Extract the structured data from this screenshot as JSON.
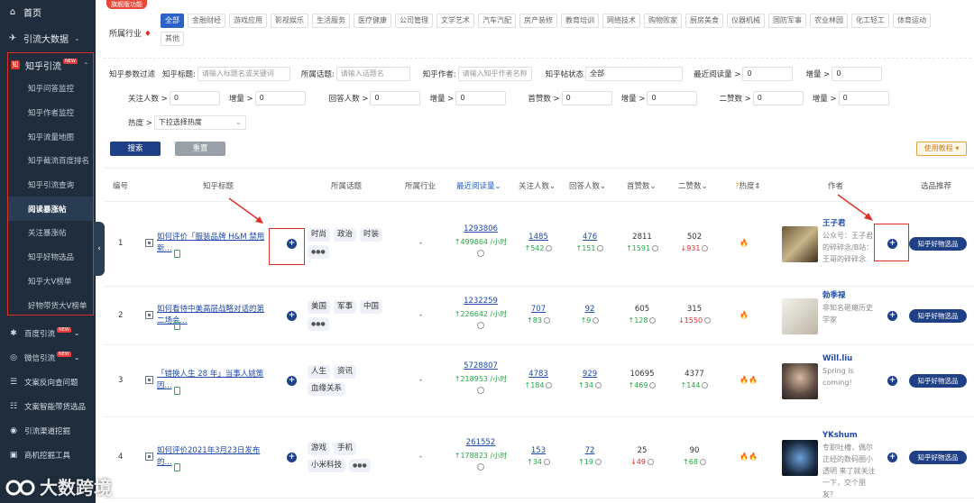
{
  "sidebar": {
    "home": "首页",
    "bigdata": "引流大数据",
    "zhihu_section": "知乎引流",
    "hot_badge": "NEW",
    "zhihu_items": [
      "知乎问答监控",
      "知乎作者监控",
      "知乎流量地图",
      "知乎截流百度排名",
      "知乎引流查询",
      "阅读暴涨帖",
      "关注暴涨帖",
      "知乎好物选品",
      "知乎大V榜单",
      "好物带货大V榜单"
    ],
    "active_index": 5,
    "baidu_section": "百度引流",
    "wechat_section": "微信引流",
    "lower_items": [
      "文案反向查问题",
      "文案智能带货选品",
      "引流渠道挖掘",
      "商机挖掘工具"
    ]
  },
  "filter": {
    "flagship_tag": "旗舰版功能",
    "industry_label": "所属行业",
    "industries": [
      "全部",
      "金融财经",
      "游戏应用",
      "影视娱乐",
      "生活服务",
      "医疗健康",
      "公司管理",
      "文学艺术",
      "汽车汽配",
      "房产装修",
      "教育培训",
      "网络技术",
      "购物败家",
      "厨房美食",
      "仪器机械",
      "国防军事",
      "农业林园",
      "化工轻工",
      "体育运动",
      "其他"
    ],
    "param_label": "知乎参数过滤",
    "title_label": "知乎标题:",
    "title_placeholder": "请输入标题名或关键词",
    "topic_label": "所属话题:",
    "topic_placeholder": "请输入话题名",
    "author_label": "知乎作者:",
    "author_placeholder": "请输入知乎作者名称",
    "status_label": "知乎帖状态",
    "status_value": "全部",
    "recent_read_label": "最近阅读量 >",
    "increase_label": "增量 >",
    "follow_label": "关注人数 >",
    "answer_label": "回答人数 >",
    "first_like_label": "首赞数 >",
    "second_like_label": "二赞数 >",
    "zero": "0",
    "heat_label": "热度 >",
    "heat_placeholder": "下拉选择热度",
    "search_btn": "搜索",
    "reset_btn": "重置",
    "tutorial_btn": "使用教程 ▾"
  },
  "table": {
    "headers": {
      "no": "编号",
      "title": "知乎标题",
      "topic": "所属话题",
      "industry": "所属行业",
      "recent_read": "最近阅读量",
      "follow": "关注人数",
      "answer": "回答人数",
      "first_like": "首赞数",
      "second_like": "二赞数",
      "heat": "热度",
      "author": "作者",
      "recommend": "选品推荐"
    },
    "rows": [
      {
        "no": "1",
        "title": "如何评价「服装品牌 H&M 禁用新...",
        "tags": [
          "时尚",
          "政治",
          "时装"
        ],
        "more": "●●●",
        "industry": "-",
        "read": "1293806",
        "read_inc": "↑499864 /小时",
        "follow": "1485",
        "follow_inc": "↑542",
        "answer": "476",
        "answer_inc": "↑151",
        "first": "2811",
        "first_inc": "↑1591",
        "second": "502",
        "second_inc": "↓931",
        "second_dir": "down",
        "heat": "🔥",
        "author": "王子君",
        "author_desc": "公众号：王子君的碎碎念/B站：王哥的碎碎念",
        "rec": "知乎好物选品"
      },
      {
        "no": "2",
        "title": "如何看待中美高层战略对话的第二场会...",
        "tags": [
          "美国",
          "军事",
          "中国"
        ],
        "more": "●●●",
        "industry": "-",
        "read": "1232259",
        "read_inc": "↑226642 /小时",
        "follow": "707",
        "follow_inc": "↑83",
        "answer": "92",
        "answer_inc": "↑9",
        "first": "605",
        "first_inc": "↑128",
        "second": "315",
        "second_inc": "↓1550",
        "second_dir": "down",
        "heat": "🔥",
        "author": "勃季禄",
        "author_desc": "非知名砸瘫历史学家",
        "rec": "知乎好物选品"
      },
      {
        "no": "3",
        "title": "「错换人生 28 年」当事人姚策因...",
        "tags": [
          "人生",
          "资讯",
          "血缘关系"
        ],
        "more": "",
        "industry": "-",
        "read": "5728807",
        "read_inc": "↑218953 /小时",
        "follow": "4783",
        "follow_inc": "↑184",
        "answer": "929",
        "answer_inc": "↑34",
        "first": "10695",
        "first_inc": "↑469",
        "second": "4377",
        "second_inc": "↑144",
        "second_dir": "up",
        "heat": "🔥🔥",
        "author": "Will.liu",
        "author_desc": "Spring is coming!",
        "rec": "知乎好物选品"
      },
      {
        "no": "4",
        "title": "如何评价2021年3月23日发布的...",
        "tags": [
          "游戏",
          "手机",
          "小米科技"
        ],
        "more": "●●●",
        "industry": "-",
        "read": "261552",
        "read_inc": "↑178823 /小时",
        "follow": "153",
        "follow_inc": "↑34",
        "answer": "72",
        "answer_inc": "↑19",
        "first": "25",
        "first_inc": "↓49",
        "second": "90",
        "second_inc": "↑68",
        "second_dir": "up",
        "heat": "🔥🔥",
        "author": "YKshum",
        "author_desc": "专职吐槽，偶尔正经的数码圈小透明 来了就关注一下，交个朋友?",
        "rec": "知乎好物选品"
      }
    ]
  },
  "watermark": "大数跨境",
  "colors": {
    "sidebar": "#1f2d3d",
    "primary": "#1f3f86",
    "link": "#1e4aa8",
    "up": "#26a646",
    "down": "#e03030",
    "highlight": "#e0302a"
  }
}
